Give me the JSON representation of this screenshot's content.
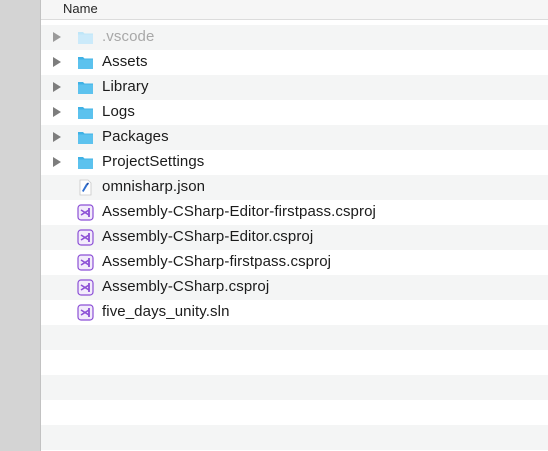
{
  "header": {
    "name_label": "Name"
  },
  "items": [
    {
      "label": ".vscode",
      "type": "folder",
      "expandable": true,
      "dimmed": true
    },
    {
      "label": "Assets",
      "type": "folder",
      "expandable": true,
      "dimmed": false
    },
    {
      "label": "Library",
      "type": "folder",
      "expandable": true,
      "dimmed": false
    },
    {
      "label": "Logs",
      "type": "folder",
      "expandable": true,
      "dimmed": false
    },
    {
      "label": "Packages",
      "type": "folder",
      "expandable": true,
      "dimmed": false
    },
    {
      "label": "ProjectSettings",
      "type": "folder",
      "expandable": true,
      "dimmed": false
    },
    {
      "label": "omnisharp.json",
      "type": "json-file",
      "expandable": false,
      "dimmed": false
    },
    {
      "label": "Assembly-CSharp-Editor-firstpass.csproj",
      "type": "visual-studio-file",
      "expandable": false,
      "dimmed": false
    },
    {
      "label": "Assembly-CSharp-Editor.csproj",
      "type": "visual-studio-file",
      "expandable": false,
      "dimmed": false
    },
    {
      "label": "Assembly-CSharp-firstpass.csproj",
      "type": "visual-studio-file",
      "expandable": false,
      "dimmed": false
    },
    {
      "label": "Assembly-CSharp.csproj",
      "type": "visual-studio-file",
      "expandable": false,
      "dimmed": false
    },
    {
      "label": "five_days_unity.sln",
      "type": "visual-studio-file",
      "expandable": false,
      "dimmed": false
    }
  ],
  "colors": {
    "folder": "#5cc2ee",
    "folder_dimmed": "#bfe6f8",
    "visual_studio": "#8c4fd6",
    "row_alt": "#f4f5f5"
  }
}
